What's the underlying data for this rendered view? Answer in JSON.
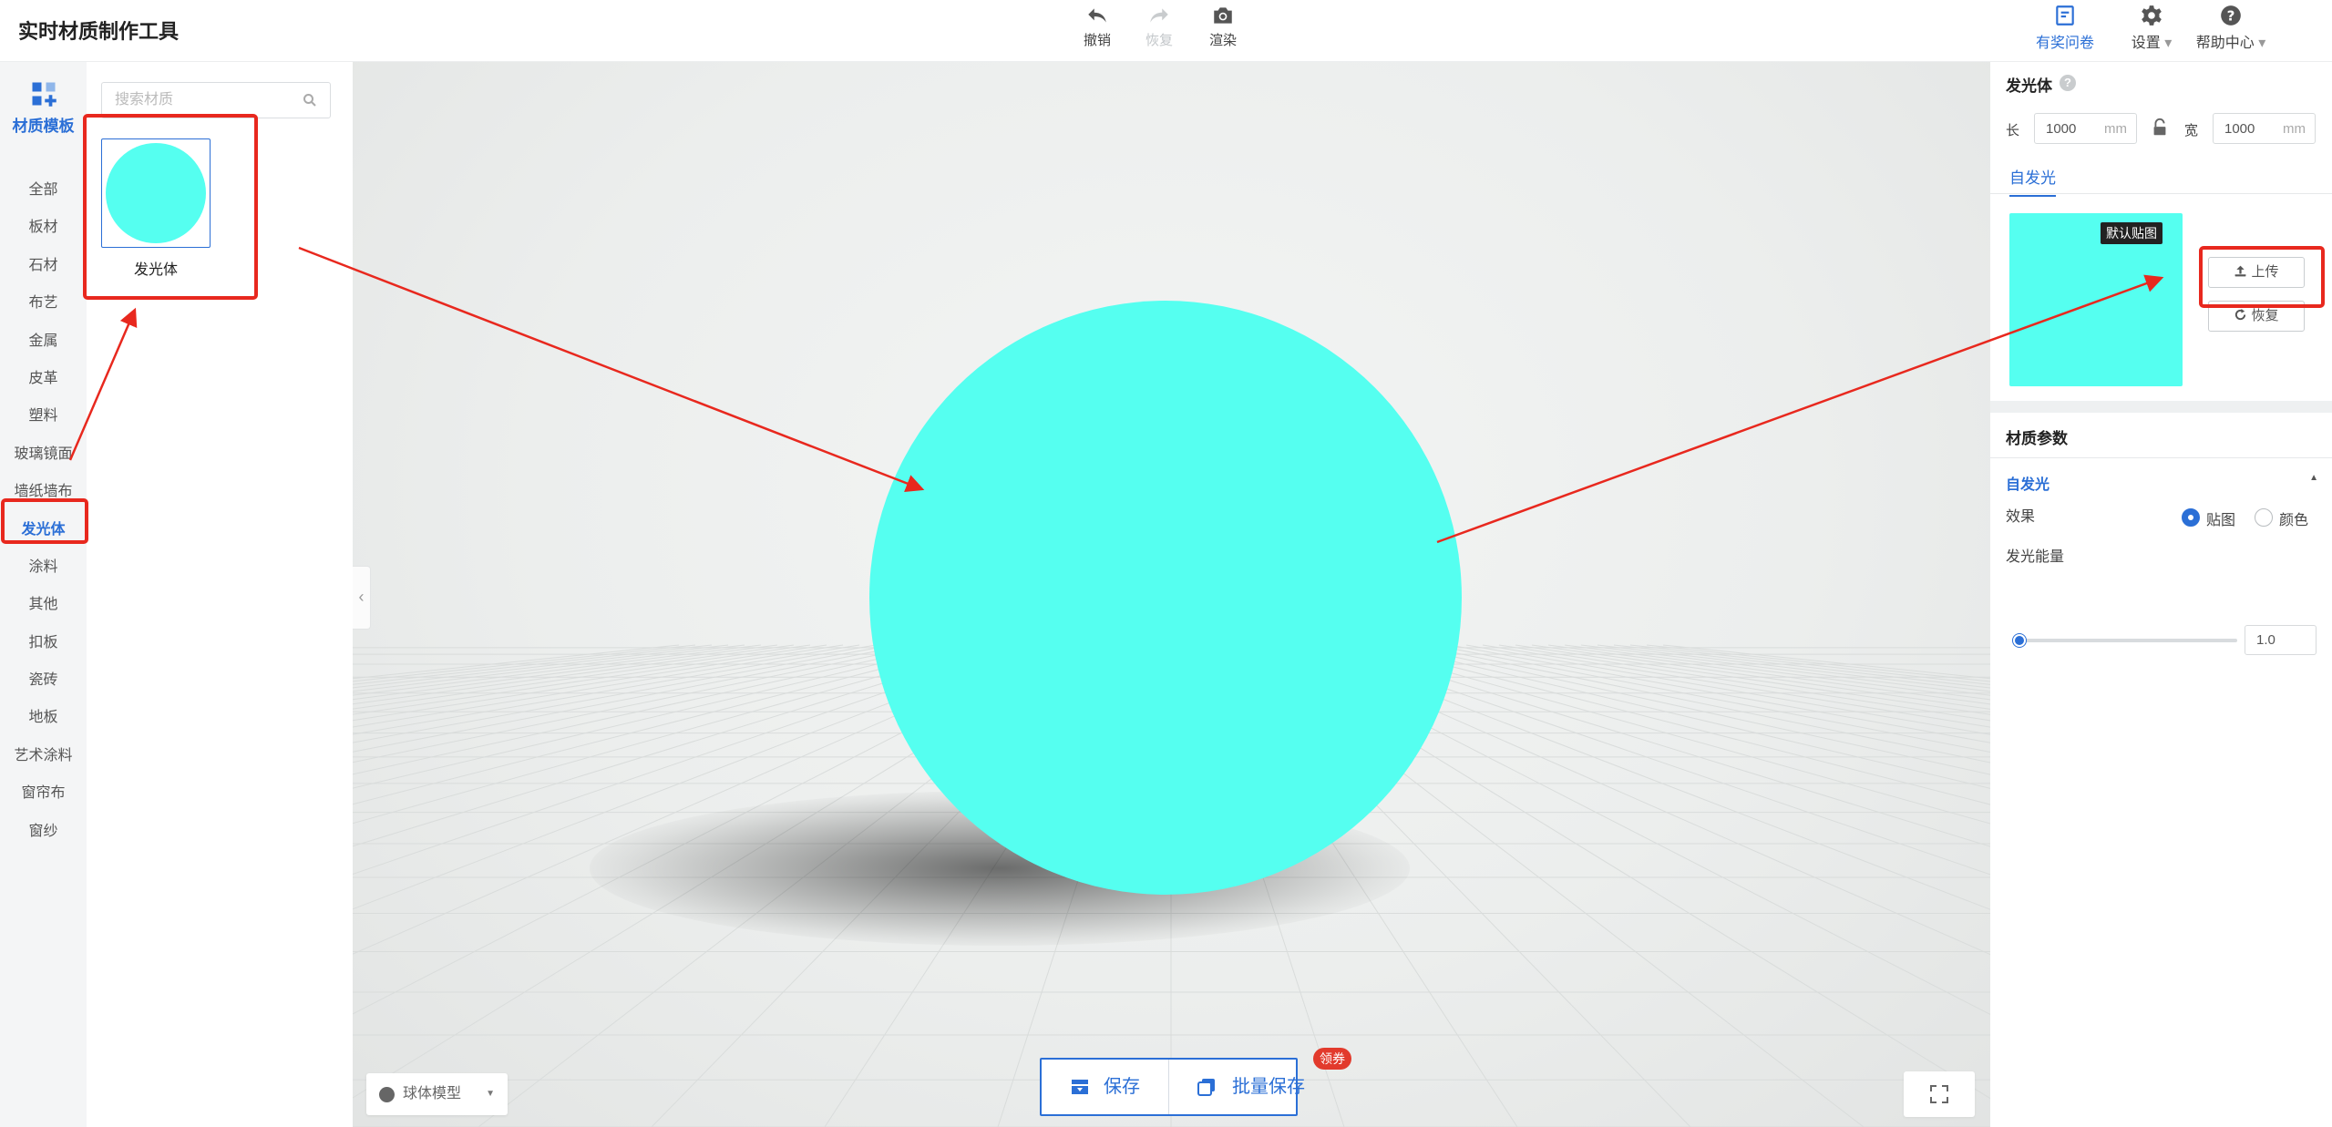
{
  "app": {
    "title": "实时材质制作工具"
  },
  "toolbar": {
    "undo": "撤销",
    "redo": "恢复",
    "render": "渲染",
    "survey": "有奖问卷",
    "settings": "设置",
    "help": "帮助中心"
  },
  "sidebar": {
    "header": "材质模板",
    "categories": [
      "全部",
      "板材",
      "石材",
      "布艺",
      "金属",
      "皮革",
      "塑料",
      "玻璃镜面",
      "墙纸墙布",
      "发光体",
      "涂料",
      "其他",
      "扣板",
      "瓷砖",
      "地板",
      "艺术涂料",
      "窗帘布",
      "窗纱"
    ],
    "active_category": "发光体"
  },
  "library": {
    "search_placeholder": "搜索材质",
    "items": [
      {
        "label": "发光体",
        "color": "#55fff0"
      }
    ]
  },
  "viewport": {
    "model_select": "球体模型",
    "save_label": "保存",
    "batch_save_label": "批量保存",
    "coupon_badge": "领券",
    "sphere_color": "#55fff0"
  },
  "properties": {
    "object_title": "发光体",
    "length_label": "长",
    "length_value": "1000",
    "width_label": "宽",
    "width_value": "1000",
    "unit": "mm",
    "tab_label": "自发光",
    "default_texture_badge": "默认贴图",
    "upload_label": "上传",
    "reset_label": "恢复",
    "params_title": "材质参数",
    "section_title": "自发光",
    "effect_label": "效果",
    "effect_options": [
      "贴图",
      "颜色"
    ],
    "effect_selected": "贴图",
    "energy_label": "发光能量",
    "energy_value": "1.0",
    "energy_fraction": 0.03
  },
  "colors": {
    "accent": "#2b6fd6",
    "emissive": "#55fff0",
    "annotation": "#e8281e"
  }
}
